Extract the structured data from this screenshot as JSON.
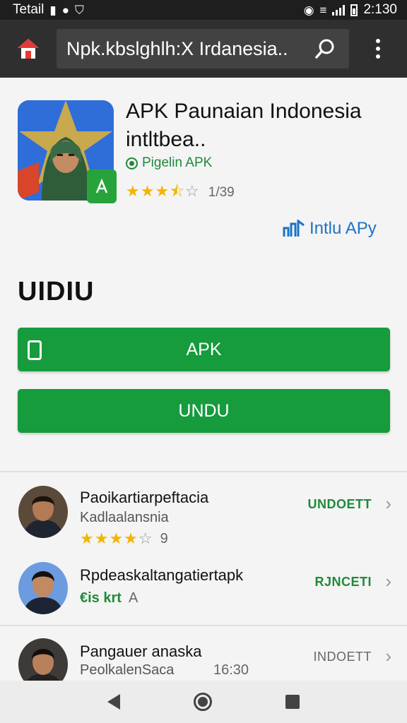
{
  "status_bar": {
    "carrier": "Tetail",
    "time": "2:130"
  },
  "browser": {
    "url": "Npk.kbslghlh:X Irdanesia.."
  },
  "app": {
    "title": "APK Paunaian Indonesia intltbea..",
    "publisher": "Pigelin APK",
    "rating": 3.5,
    "rating_stars": "★★★",
    "rating_half": "⯪",
    "rating_empty": "☆",
    "rating_count": "1/39",
    "install_link": "Intlu APy"
  },
  "section_heading": "UIDIU",
  "buttons": {
    "apk": "APK",
    "undu": "UNDU"
  },
  "list": [
    {
      "title": "Paoikartiarpeftacia",
      "subtitle": "Kadlaalansnia",
      "stars": "★★★★",
      "stars_empty": "☆",
      "meta_value": "9",
      "action": "UNDOETT"
    },
    {
      "title": "Rpdeaskaltangatiertapk",
      "meta_green": "€is krt",
      "meta_value": "A",
      "action": "RJNCETI"
    },
    {
      "title": "Pangauer anaska",
      "subtitle": "PeolkalenSaca",
      "meta_value": "16:30",
      "action": "INDOETT"
    }
  ],
  "colors": {
    "green": "#169b3d",
    "status_bar": "#1e1e1e",
    "browser_bar": "#2f2f2f",
    "link_blue": "#1a73c8",
    "star": "#f4b400"
  },
  "icons": {
    "home": "home-icon",
    "search": "search-icon",
    "menu": "more-vert-icon",
    "install": "install-icon",
    "chevron": "chevron-right-icon"
  }
}
